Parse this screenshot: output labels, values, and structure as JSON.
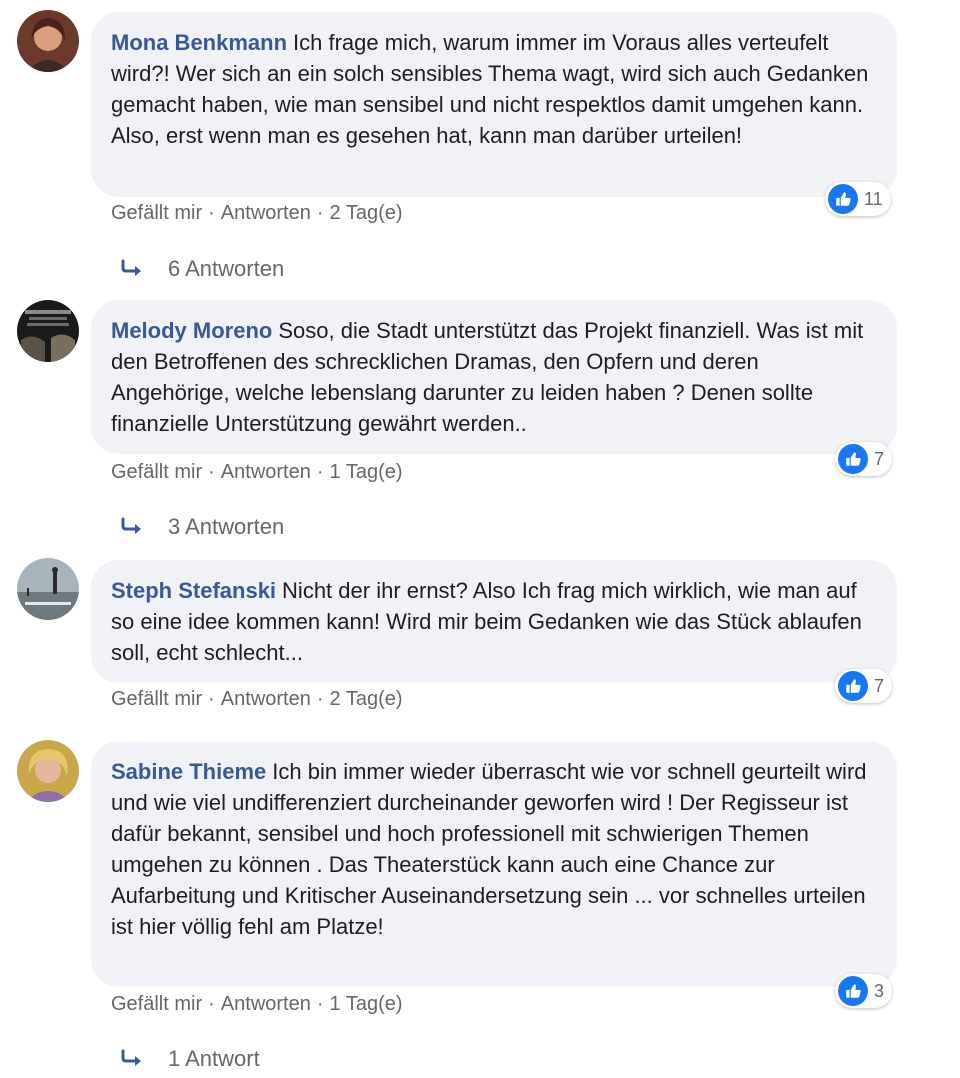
{
  "comments": [
    {
      "author": "Mona Benkmann",
      "text": "Ich frage mich, warum immer im Voraus alles verteufelt wird?! Wer sich an ein solch sensibles Thema wagt, wird sich auch Gedanken gemacht haben, wie man sensibel und nicht respektlos damit umgehen kann. Also, erst wenn man es gesehen hat, kann man darüber urteilen!",
      "like_label": "Gefällt mir",
      "reply_label": "Antworten",
      "separator": "·",
      "time": "2 Tag(e)",
      "reaction_count": "11",
      "replies_label": "6 Antworten",
      "reaction_icon": "like-icon"
    },
    {
      "author": "Melody Moreno",
      "text": "Soso, die Stadt unterstützt das Projekt finanziell. Was ist mit den Betroffenen des schrecklichen Dramas, den Opfern und deren Angehörige, welche lebenslang darunter zu leiden haben ? Denen sollte finanzielle Unterstützung gewährt werden..",
      "like_label": "Gefällt mir",
      "reply_label": "Antworten",
      "separator": "·",
      "time": "1 Tag(e)",
      "reaction_count": "7",
      "replies_label": "3 Antworten",
      "reaction_icon": "like-icon"
    },
    {
      "author": "Steph Stefanski",
      "text": "Nicht der ihr ernst? Also Ich frag mich wirklich, wie man auf so eine idee kommen kann! Wird mir beim Gedanken wie das Stück ablaufen soll, echt schlecht...",
      "like_label": "Gefällt mir",
      "reply_label": "Antworten",
      "separator": "·",
      "time": "2 Tag(e)",
      "reaction_count": "7",
      "reaction_icon": "like-icon"
    },
    {
      "author": "Sabine Thieme",
      "text": "Ich bin immer wieder überrascht wie vor schnell geurteilt wird und wie viel undifferenziert durcheinander geworfen wird ! Der Regisseur ist dafür bekannt, sensibel und hoch professionell mit schwierigen Themen umgehen zu können . Das Theaterstück kann auch eine Chance zur Aufarbeitung und Kritischer Auseinandersetzung sein ... vor schnelles urteilen ist hier völlig fehl am Platze!",
      "like_label": "Gefällt mir",
      "reply_label": "Antworten",
      "separator": "·",
      "time": "1 Tag(e)",
      "reaction_count": "3",
      "replies_label": "1 Antwort",
      "reaction_icon": "like-icon"
    }
  ],
  "colors": {
    "author": "#385898",
    "bubble": "#f0f2f5",
    "meta": "#65676b",
    "like_blue": "#1877f2"
  }
}
